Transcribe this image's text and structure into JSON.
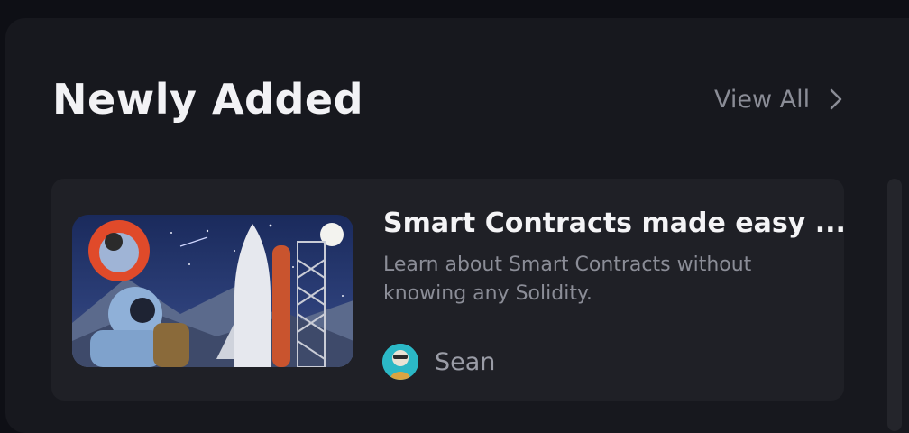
{
  "section": {
    "title": "Newly Added",
    "view_all_label": "View All",
    "view_all_icon": "chevron-right-icon"
  },
  "course": {
    "title": "Smart Contracts made easy ...",
    "description": "Learn about Smart Contracts without knowing any Solidity.",
    "thumbnail": "astronaut-rocket-launch-illustration",
    "author": {
      "name": "Sean",
      "avatar": "cyan-avatar"
    }
  },
  "colors": {
    "background": "#0e0f15",
    "panel": "#17181e",
    "card": "#1f2026",
    "title_text": "#f2f2f5",
    "muted_text": "#8a8c96",
    "accent_avatar": "#2bb8c6"
  }
}
